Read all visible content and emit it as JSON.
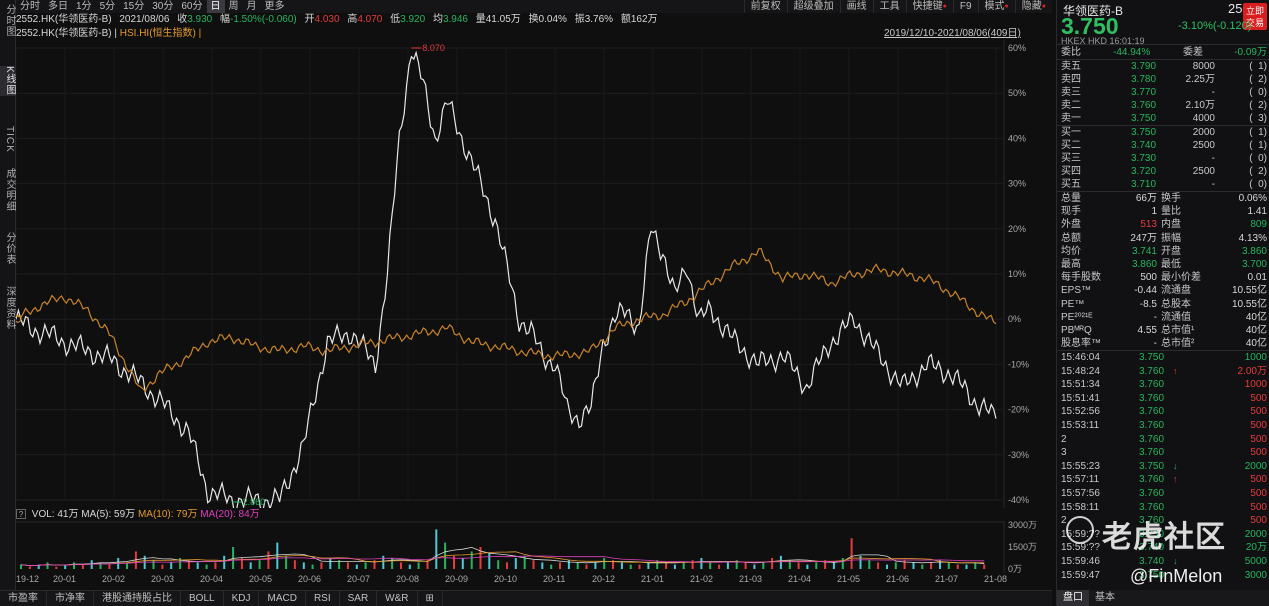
{
  "leftbar": [
    {
      "label": "分时图"
    },
    {
      "label": "K线图",
      "active": true
    },
    {
      "label": "TICK"
    },
    {
      "label": "成交明细"
    },
    {
      "label": "分价表"
    },
    {
      "label": "深度资料"
    }
  ],
  "periods": [
    "分时",
    "多日",
    "1分",
    "5分",
    "15分",
    "30分",
    "60分",
    "日",
    "周",
    "月",
    "更多"
  ],
  "active_period": "日",
  "tools": [
    "前复权",
    "超级叠加",
    "画线",
    "工具",
    "快捷键",
    "F9",
    "模式",
    "隐藏"
  ],
  "quote": {
    "symbol": "2552.HK(华领医药-B)",
    "date": "2021/08/06",
    "close_label": "收",
    "close": "3.930",
    "amp_label": "幅",
    "change": "-1.50%(-0.060)",
    "open_label": "开",
    "open": "4.030",
    "high_label": "高",
    "high": "4.070",
    "low_label": "低",
    "low": "3.920",
    "avg_label": "均",
    "avg": "3.946",
    "volume": "量41.05万",
    "turnover": "换0.04%",
    "swing": "振3.76%",
    "amount": "额162万"
  },
  "legend": {
    "stock": "2552.HK(华领医药-B)",
    "index": "HSI.HI(恒生指数)",
    "date_range": "2019/12/10-2021/08/06(409日)"
  },
  "chart_data": {
    "type": "line",
    "x_ticks": [
      "19-12",
      "20-01",
      "20-02",
      "20-03",
      "20-04",
      "20-05",
      "20-06",
      "20-07",
      "20-08",
      "20-09",
      "20-10",
      "20-11",
      "20-12",
      "21-01",
      "21-02",
      "21-03",
      "21-04",
      "21-05",
      "21-06",
      "21-07",
      "21-08"
    ],
    "y_ticks": [
      "60%",
      "50%",
      "40%",
      "30%",
      "20%",
      "10%",
      "0%",
      "-10%",
      "-20%",
      "-30%",
      "-40%"
    ],
    "ylim": [
      -40,
      60
    ],
    "annotations": {
      "max": "8.070",
      "min": "2.860"
    },
    "series": [
      {
        "name": "2552.HK(华领医药-B)",
        "color": "#e8e8e8",
        "x": [
          0,
          6,
          12,
          20,
          30,
          40,
          52,
          60,
          72,
          80,
          90,
          100,
          110,
          120,
          130,
          140,
          150,
          155,
          160,
          165,
          170,
          175,
          180,
          190,
          200,
          210,
          215,
          220,
          225,
          230,
          235,
          240,
          245,
          250,
          255,
          260,
          265,
          270,
          275,
          280,
          285,
          290,
          300,
          310,
          320,
          330,
          340,
          350,
          360,
          370,
          380,
          390,
          400,
          409
        ],
        "y": [
          0,
          -2,
          -3,
          -5,
          -7,
          -9,
          -14,
          -18,
          -25,
          -38,
          -40,
          -40,
          -40,
          -28,
          -5,
          -3,
          -10,
          10,
          40,
          60,
          52,
          40,
          48,
          35,
          22,
          0,
          -3,
          -8,
          -10,
          -20,
          -22,
          -20,
          -5,
          0,
          2,
          -2,
          20,
          15,
          5,
          12,
          0,
          2,
          -5,
          -10,
          -8,
          -15,
          -5,
          0,
          -8,
          -15,
          -10,
          -12,
          -18,
          -22
        ]
      },
      {
        "name": "HSI.HI(恒生指数)",
        "color": "#c8832a",
        "x": [
          0,
          10,
          20,
          30,
          40,
          52,
          60,
          70,
          80,
          90,
          100,
          110,
          120,
          130,
          140,
          150,
          160,
          170,
          180,
          190,
          200,
          210,
          220,
          230,
          240,
          250,
          260,
          270,
          280,
          290,
          300,
          310,
          320,
          330,
          340,
          350,
          360,
          370,
          380,
          390,
          400,
          409
        ],
        "y": [
          0,
          3,
          5,
          2,
          -4,
          -16,
          -12,
          -9,
          -5,
          -4,
          -6,
          -7,
          -6,
          -7,
          -6,
          -5,
          -4,
          -3,
          -2,
          -5,
          -6,
          -7,
          -8,
          -8,
          -7,
          -2,
          0,
          1,
          4,
          8,
          12,
          15,
          9,
          10,
          8,
          10,
          11,
          10,
          9,
          6,
          2,
          -1
        ]
      }
    ]
  },
  "volume": {
    "legend_q": "?",
    "vol": "VOL: 41万",
    "ma5": "MA(5): 59万",
    "ma10": "MA(10): 79万",
    "ma20": "MA(20): 84万",
    "y_ticks": [
      "3000万",
      "1500万",
      "0万"
    ],
    "bars": [
      2,
      1,
      2,
      3,
      1,
      2,
      3,
      2,
      4,
      3,
      2,
      5,
      3,
      8,
      6,
      4,
      2,
      3,
      5,
      4,
      3,
      2,
      3,
      6,
      10,
      5,
      3,
      4,
      8,
      12,
      6,
      4,
      3,
      2,
      3,
      5,
      4,
      3,
      2,
      3,
      4,
      6,
      5,
      3,
      2,
      3,
      4,
      18,
      12,
      6,
      5,
      8,
      10,
      7,
      4,
      3,
      5,
      6,
      4,
      3,
      2,
      3,
      4,
      3,
      2,
      3,
      5,
      4,
      3,
      2,
      2,
      3,
      4,
      3,
      2,
      3,
      4,
      5,
      3,
      2,
      3,
      4,
      3,
      2,
      3,
      5,
      6,
      4,
      3,
      2,
      3,
      4,
      3,
      5,
      14,
      6,
      4,
      3,
      2,
      3,
      4,
      3,
      2,
      3,
      4,
      3,
      2,
      2,
      3,
      2
    ]
  },
  "bottom_tabs": [
    "市盈率",
    "市净率",
    "港股通持股占比",
    "BOLL",
    "KDJ",
    "MACD",
    "RSI",
    "SAR",
    "W&R"
  ],
  "right": {
    "name": "华领医药-B",
    "code": "2552",
    "trade_button": "立即交易",
    "price": "3.750",
    "change": "-3.10%(-0.120)",
    "sub": "HKEX  HKD  16:01:19",
    "commission_ratio_label": "委比",
    "commission_ratio": "-44.94%",
    "commission_diff_label": "委差",
    "commission_diff": "-0.09万",
    "asks": [
      {
        "label": "卖五",
        "price": "3.790",
        "vol": "8000",
        "count": "1"
      },
      {
        "label": "卖四",
        "price": "3.780",
        "vol": "2.25万",
        "count": "2"
      },
      {
        "label": "卖三",
        "price": "3.770",
        "vol": "-",
        "count": "0"
      },
      {
        "label": "卖二",
        "price": "3.760",
        "vol": "2.10万",
        "count": "2"
      },
      {
        "label": "卖一",
        "price": "3.750",
        "vol": "4000",
        "count": "3"
      }
    ],
    "bids": [
      {
        "label": "买一",
        "price": "3.750",
        "vol": "2000",
        "count": "1"
      },
      {
        "label": "买二",
        "price": "3.740",
        "vol": "2500",
        "count": "1"
      },
      {
        "label": "买三",
        "price": "3.730",
        "vol": "-",
        "count": "0"
      },
      {
        "label": "买四",
        "price": "3.720",
        "vol": "2500",
        "count": "2"
      },
      {
        "label": "买五",
        "price": "3.710",
        "vol": "-",
        "count": "0"
      }
    ],
    "stats": [
      {
        "l1": "总量",
        "v1": "66万",
        "c1": "white",
        "l2": "换手",
        "v2": "0.06%",
        "c2": "white"
      },
      {
        "l1": "现手",
        "v1": "1",
        "c1": "white",
        "l2": "量比",
        "v2": "1.41",
        "c2": "white"
      },
      {
        "l1": "外盘",
        "v1": "513",
        "c1": "red",
        "l2": "内盘",
        "v2": "809",
        "c2": "green"
      },
      {
        "l1": "总额",
        "v1": "247万",
        "c1": "white",
        "l2": "振幅",
        "v2": "4.13%",
        "c2": "white"
      },
      {
        "l1": "均价",
        "v1": "3.741",
        "c1": "green",
        "l2": "开盘",
        "v2": "3.860",
        "c2": "green"
      },
      {
        "l1": "最高",
        "v1": "3.860",
        "c1": "green",
        "l2": "最低",
        "v2": "3.700",
        "c2": "green"
      },
      {
        "l1": "每手股数",
        "v1": "500",
        "c1": "white",
        "l2": "最小价差",
        "v2": "0.01",
        "c2": "white"
      },
      {
        "l1": "EPS™",
        "v1": "-0.44",
        "c1": "white",
        "l2": "流通盘",
        "v2": "10.55亿",
        "c2": "white"
      },
      {
        "l1": "PE™",
        "v1": "-8.5",
        "c1": "white",
        "l2": "总股本",
        "v2": "10.55亿",
        "c2": "white"
      },
      {
        "l1": "PE²⁰²¹ᴱ",
        "v1": "-",
        "c1": "white",
        "l2": "流通值",
        "v2": "40亿",
        "c2": "white"
      },
      {
        "l1": "PBᴹᴿQ",
        "v1": "4.55",
        "c1": "white",
        "l2": "总市值¹",
        "v2": "40亿",
        "c2": "white"
      },
      {
        "l1": "股息率™",
        "v1": "-",
        "c1": "white",
        "l2": "总市值²",
        "v2": "40亿",
        "c2": "white"
      }
    ],
    "ticks": [
      {
        "time": "15:46:04",
        "price": "3.750",
        "pc": "green",
        "arrow": "",
        "vol": "1000",
        "vc": "green"
      },
      {
        "time": "15:48:24",
        "price": "3.760",
        "pc": "green",
        "arrow": "↑",
        "vol": "2.00万",
        "vc": "red"
      },
      {
        "time": "15:51:34",
        "price": "3.760",
        "pc": "green",
        "arrow": "",
        "vol": "1000",
        "vc": "red"
      },
      {
        "time": "15:51:41",
        "price": "3.760",
        "pc": "green",
        "arrow": "",
        "vol": "500",
        "vc": "red"
      },
      {
        "time": "15:52:56",
        "price": "3.760",
        "pc": "green",
        "arrow": "",
        "vol": "500",
        "vc": "red"
      },
      {
        "time": "15:53:11",
        "price": "3.760",
        "pc": "green",
        "arrow": "",
        "vol": "500",
        "vc": "red"
      },
      {
        "time": "2",
        "price": "3.760",
        "pc": "green",
        "arrow": "",
        "vol": "500",
        "vc": "red"
      },
      {
        "time": "3",
        "price": "3.760",
        "pc": "green",
        "arrow": "",
        "vol": "500",
        "vc": "red"
      },
      {
        "time": "15:55:23",
        "price": "3.750",
        "pc": "green",
        "arrow": "↓",
        "vol": "2000",
        "vc": "green"
      },
      {
        "time": "15:57:11",
        "price": "3.760",
        "pc": "green",
        "arrow": "↑",
        "vol": "500",
        "vc": "red"
      },
      {
        "time": "15:57:56",
        "price": "3.760",
        "pc": "green",
        "arrow": "",
        "vol": "500",
        "vc": "red"
      },
      {
        "time": "15:58:11",
        "price": "3.760",
        "pc": "green",
        "arrow": "",
        "vol": "500",
        "vc": "red"
      },
      {
        "time": "2",
        "price": "3.760",
        "pc": "green",
        "arrow": "",
        "vol": "500",
        "vc": "red"
      },
      {
        "time": "15:59:??",
        "price": "3.750",
        "pc": "green",
        "arrow": "",
        "vol": "2000",
        "vc": "green"
      },
      {
        "time": "15:59:??",
        "price": "3.740",
        "pc": "green",
        "arrow": "",
        "vol": "20万",
        "vc": "green"
      },
      {
        "time": "15:59:46",
        "price": "3.740",
        "pc": "green",
        "arrow": "↓",
        "vol": "5000",
        "vc": "green"
      },
      {
        "time": "15:59:47",
        "price": "3.750",
        "pc": "green",
        "arrow": "",
        "vol": "3000",
        "vc": "green"
      }
    ],
    "tabs": [
      "盘口",
      "基本"
    ]
  },
  "watermark": {
    "text": "老虎社区",
    "handle": "@FinMelon"
  }
}
